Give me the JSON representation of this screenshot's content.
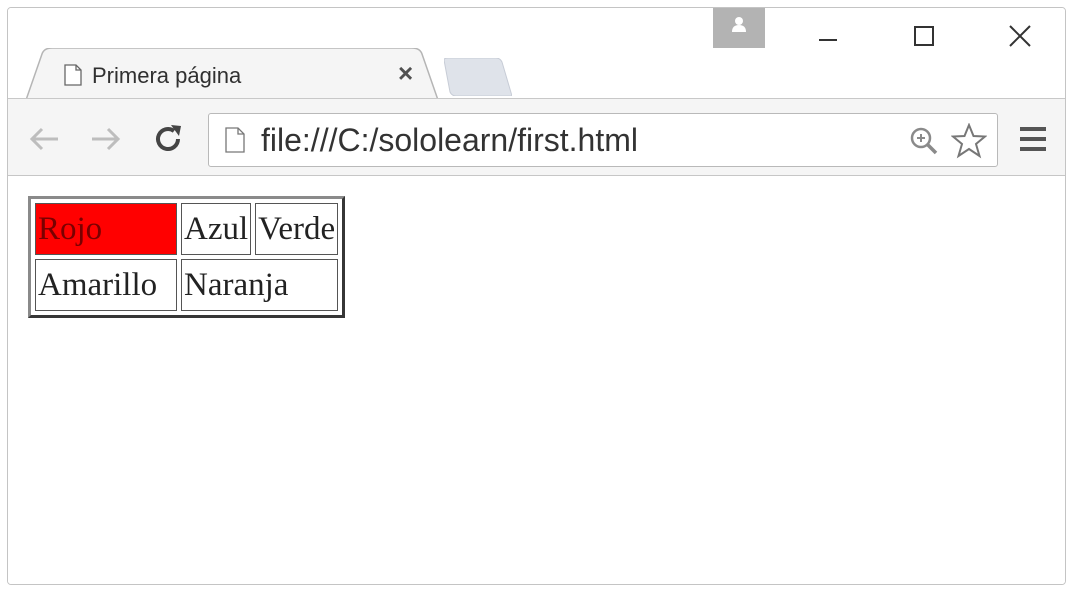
{
  "tab": {
    "title": "Primera página",
    "close_glyph": "×"
  },
  "address_bar": {
    "url": "file:///C:/sololearn/first.html"
  },
  "icons": [
    "profile-icon",
    "minimize-icon",
    "maximize-icon",
    "close-icon",
    "page-icon",
    "back-icon",
    "forward-icon",
    "reload-icon",
    "zoom-icon",
    "star-icon",
    "menu-icon"
  ],
  "table": {
    "rows": [
      [
        {
          "text": "Rojo",
          "bg": "#ff0000"
        },
        {
          "text": "Azul"
        },
        {
          "text": "Verde"
        }
      ],
      [
        {
          "text": "Amarillo"
        },
        {
          "text": "Naranja",
          "colspan": 2
        }
      ]
    ]
  },
  "colors": {
    "highlight": "#ff0000"
  }
}
